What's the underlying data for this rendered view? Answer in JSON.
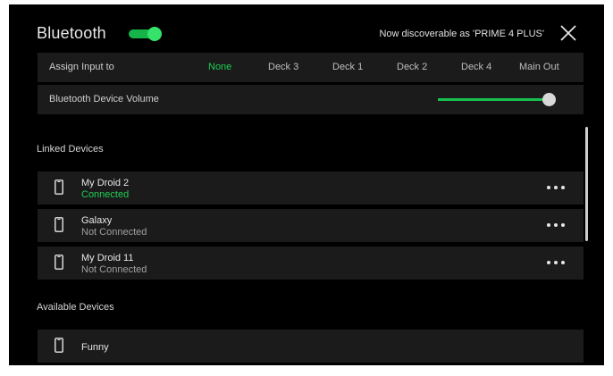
{
  "header": {
    "title": "Bluetooth",
    "toggle_state": "on",
    "discoverable_text": "Now discoverable as 'PRIME 4 PLUS'"
  },
  "assign": {
    "label": "Assign Input to",
    "options": [
      "None",
      "Deck 3",
      "Deck 1",
      "Deck 2",
      "Deck 4",
      "Main Out"
    ],
    "selected": "None"
  },
  "volume": {
    "label": "Bluetooth Device Volume",
    "level": 0.95
  },
  "linked": {
    "title": "Linked Devices",
    "devices": [
      {
        "name": "My Droid 2",
        "status": "Connected"
      },
      {
        "name": "Galaxy",
        "status": "Not Connected"
      },
      {
        "name": "My Droid 11",
        "status": "Not Connected"
      }
    ]
  },
  "available": {
    "title": "Available Devices",
    "devices": [
      {
        "name": "Funny"
      }
    ]
  },
  "colors": {
    "accent": "#1fcc55",
    "background": "#000000",
    "row": "#1b1b1b"
  }
}
